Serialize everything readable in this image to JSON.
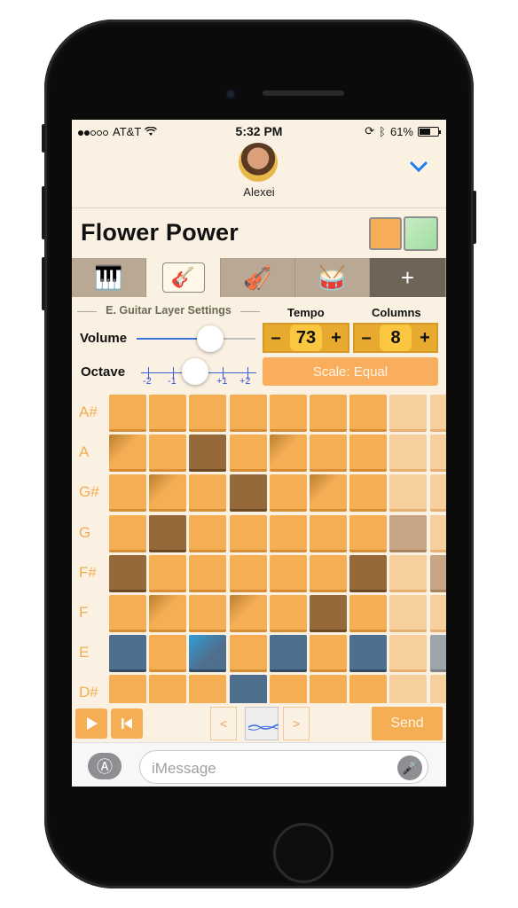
{
  "status": {
    "carrier": "AT&T",
    "time": "5:32 PM",
    "battery": "61%",
    "battery_level": 0.61
  },
  "header": {
    "contact_name": "Alexei"
  },
  "song": {
    "title": "Flower Power"
  },
  "tabs": [
    {
      "name": "piano",
      "icon": "piano-icon"
    },
    {
      "name": "e-guitar",
      "icon": "guitar-icon",
      "active": true
    },
    {
      "name": "violin",
      "icon": "violin-icon"
    },
    {
      "name": "drums",
      "icon": "drums-icon"
    },
    {
      "name": "add",
      "label": "+"
    }
  ],
  "layer_settings": {
    "title": "E. Guitar Layer Settings",
    "volume_label": "Volume",
    "volume_level": 0.62,
    "octave_label": "Octave",
    "octave_ticks": [
      "-2",
      "-1",
      "+1",
      "+2"
    ],
    "octave_value": 0
  },
  "tempo": {
    "label": "Tempo",
    "value": "73",
    "minus": "–",
    "plus": "+"
  },
  "columns": {
    "label": "Columns",
    "value": "8",
    "minus": "–",
    "plus": "+"
  },
  "scale_button": "Scale: Equal",
  "notes": [
    "A#",
    "A",
    "G#",
    "G",
    "F#",
    "F",
    "E",
    "D#"
  ],
  "grid": [
    [
      "n",
      "n",
      "n",
      "n",
      "n",
      "n",
      "n",
      "p",
      "p"
    ],
    [
      "g",
      "n",
      "d",
      "n",
      "g",
      "n",
      "n",
      "p",
      "p"
    ],
    [
      "n",
      "g",
      "n",
      "d",
      "n",
      "g",
      "n",
      "p",
      "p"
    ],
    [
      "n",
      "d",
      "n",
      "n",
      "n",
      "n",
      "n",
      "t",
      "p"
    ],
    [
      "d",
      "n",
      "n",
      "n",
      "n",
      "n",
      "d",
      "p",
      "t"
    ],
    [
      "n",
      "g",
      "n",
      "g",
      "n",
      "d",
      "n",
      "p",
      "p"
    ],
    [
      "b",
      "n",
      "c",
      "n",
      "b",
      "n",
      "b",
      "p",
      "x"
    ],
    [
      "n",
      "n",
      "n",
      "b",
      "n",
      "n",
      "n",
      "p",
      "p"
    ]
  ],
  "bottom": {
    "prev": "<",
    "next": ">",
    "send": "Send"
  },
  "imessage": {
    "placeholder": "iMessage"
  }
}
